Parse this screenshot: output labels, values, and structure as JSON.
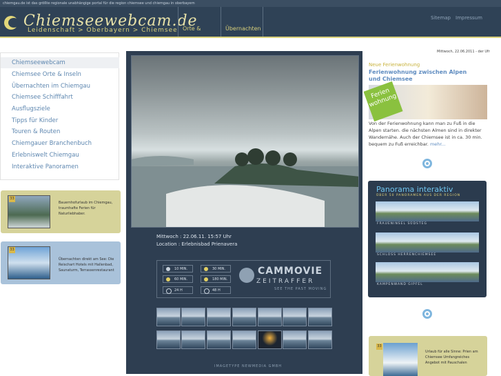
{
  "top_strip": "chiemgau.de ist das größte regionale unabhängige portal für die region chiemsee und chiemgau in oberbayern",
  "logo": {
    "text": "Chiemseewebcam.de"
  },
  "breadcrumb": "Leidenschaft > Oberbayern > Chiemsee",
  "nav": {
    "tab1": "Orte & Inseln",
    "tab2": "Übernachten"
  },
  "header_links": {
    "sitemap": "Sitemap",
    "impressum": "Impressum"
  },
  "sidebar": {
    "items": [
      {
        "label": "Chiemseewebcam"
      },
      {
        "label": "Chiemsee Orte & Inseln"
      },
      {
        "label": "Übernachten im Chiemgau"
      },
      {
        "label": "Chiemsee Schifffahrt"
      },
      {
        "label": "Ausflugsziele"
      },
      {
        "label": "Tipps für Kinder"
      },
      {
        "label": "Touren & Routen"
      },
      {
        "label": "Chiemgauer Branchenbuch"
      },
      {
        "label": "Erlebniswelt Chiemgau"
      },
      {
        "label": "Interaktive Panoramen"
      }
    ]
  },
  "promos": {
    "promo1": {
      "badge": "33",
      "text": "Bauernhofurlaub im Chiemgau, traumhafte Ferien für Naturliebhaber."
    },
    "promo2": {
      "badge": "33",
      "text": "Übernachten direkt am See: Die Reischart Hotels mit Hallenbad, Saunaturm, Terrassenrestaurant"
    },
    "promo3": {
      "badge": "33",
      "text": "Urlaub für alle Sinne: Prien am Chiemsee Umfangreiches Angebot mit Pauschalen"
    }
  },
  "webcam": {
    "datetime": "Mittwoch : 22.06.11. 15:57  Uhr",
    "location": "Location : Erlebnisbad Prienavera"
  },
  "timelapse": {
    "buttons": [
      "10 MIN.",
      "30 MIN.",
      "60 MIN.",
      "180 MIN.",
      "24 H",
      "48 H"
    ],
    "brand": "CAMMOVIE",
    "brand_sub": "ZEITRAFFER",
    "tagline": "SEE THE PAST MOVING"
  },
  "credit": "IMAGETYPE NEWMEDIA GMBH",
  "right": {
    "date": "Mittwoch, 22.06.2011 - der Ufr",
    "kicker": "Neue Ferienwohnung",
    "title": "Ferienwohnung zwischen Alpen und Chiemsee",
    "flag": "Ferien wohnung",
    "text": "Von der Ferienwohnung kann man zu Fuß in die Alpen starten. die nächsten Almen sind in direkter Wandernähe. Auch der Chiemsee ist in ca. 30 min. bequem zu Fuß erreichbar.",
    "more": "mehr..."
  },
  "panorama": {
    "title": "Panorama interaktiv",
    "subtitle": "ÜBER 50 PANORAMEN AUS DER REGION",
    "items": [
      {
        "caption": "FRAUENINSEL SÜDSTEG"
      },
      {
        "caption": "SCHLOSS HERRENCHIEMSEE"
      },
      {
        "caption": "KAMPENWAND GIPFEL"
      }
    ]
  },
  "colors": {
    "header_bg": "#2f4256",
    "accent": "#d9d07a",
    "link": "#5e87b0",
    "center_bg": "#2e3e51"
  }
}
